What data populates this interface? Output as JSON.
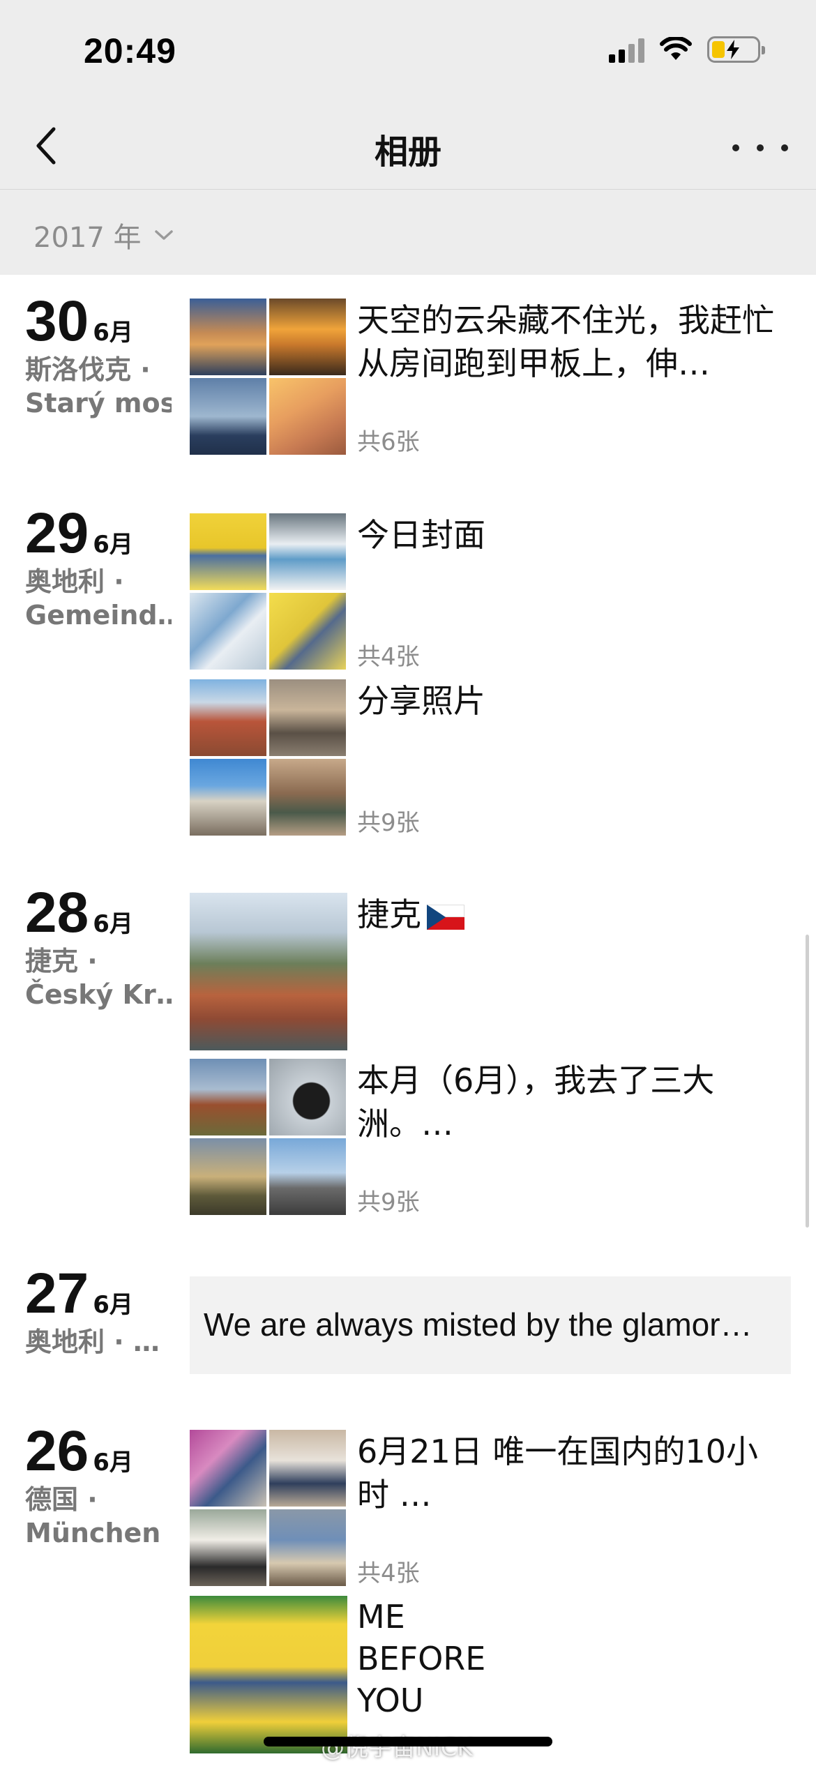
{
  "status_bar": {
    "time": "20:49"
  },
  "nav": {
    "title": "相册"
  },
  "filter": {
    "year": "2017 年"
  },
  "days": [
    {
      "day": "30",
      "month": "6月",
      "location_line1": "斯洛伐克 ·",
      "location_line2": "Starý most",
      "posts": [
        {
          "text": "天空的云朵藏不住光，我赶忙从房间跑到甲板上，伸…",
          "count": "共6张"
        }
      ]
    },
    {
      "day": "29",
      "month": "6月",
      "location_line1": "奥地利 ·",
      "location_line2": "Gemeind…",
      "posts": [
        {
          "text": "今日封面",
          "count": "共4张"
        },
        {
          "text": "分享照片",
          "count": "共9张"
        }
      ]
    },
    {
      "day": "28",
      "month": "6月",
      "location_line1": "捷克 ·",
      "location_line2": "Český Kr…",
      "posts": [
        {
          "text": "捷克"
        },
        {
          "text": "本月（6月），我去了三大洲。…",
          "count": "共9张"
        }
      ]
    },
    {
      "day": "27",
      "month": "6月",
      "location_line1": "奥地利 · …",
      "posts": [
        {
          "text": "We are always misted by the glamor…"
        }
      ]
    },
    {
      "day": "26",
      "month": "6月",
      "location_line1": "德国 ·",
      "location_line2": "München",
      "posts": [
        {
          "text": "6月21日  唯一在国内的10小时 …",
          "count": "共4张"
        },
        {
          "text_lines": [
            "ME",
            "BEFORE",
            "YOU"
          ]
        }
      ]
    }
  ],
  "watermark": "@倪宇宙NICK",
  "colors": {
    "bar_bg": "#ededed",
    "muted": "#8c8c8c",
    "battery_fill": "#f5c400"
  }
}
